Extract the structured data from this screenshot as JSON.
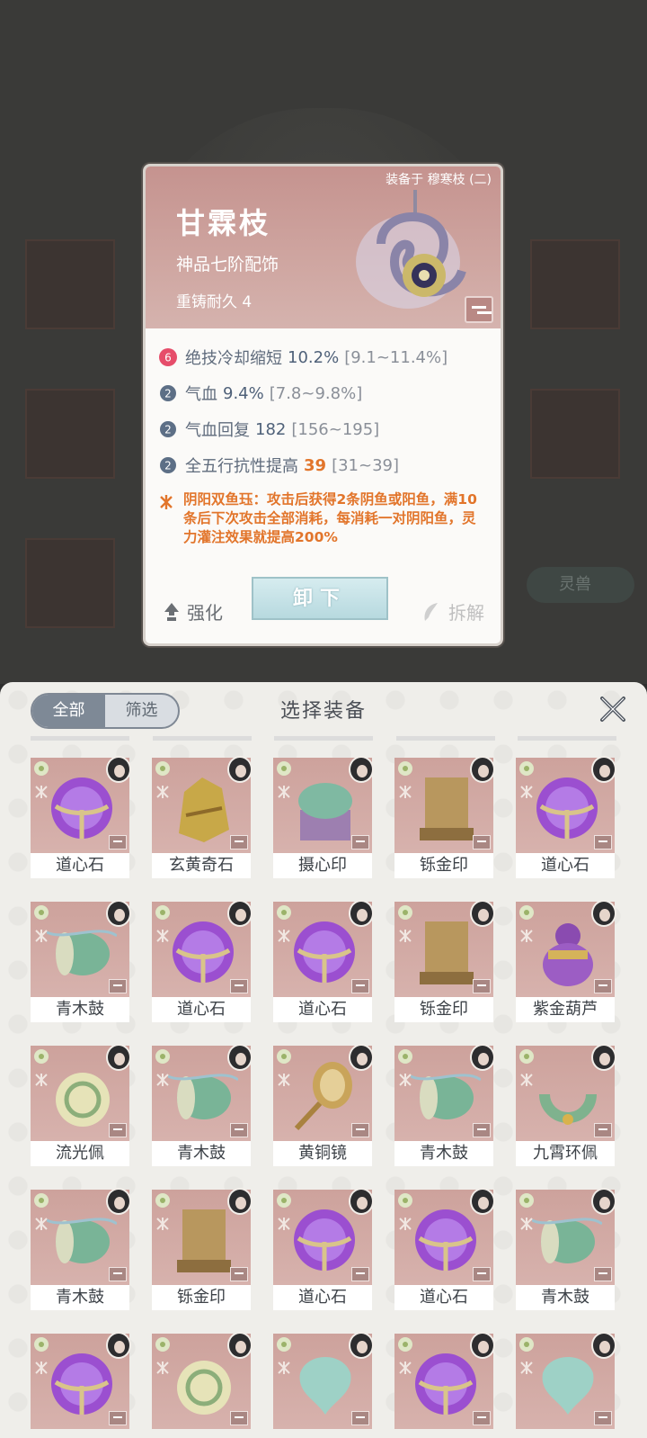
{
  "background": {
    "side_button": "灵兽"
  },
  "tooltip": {
    "equipped_on": "装备于 穆寒枝 (二)",
    "name": "甘霖枝",
    "grade": "神品七阶配饰",
    "durability": "重铸耐久 4",
    "stats": [
      {
        "icon": "rank-6-badge-icon",
        "label": "绝技冷却缩短",
        "value": "10.2%",
        "range": "[9.1~11.4%]",
        "highlight": false
      },
      {
        "icon": "blue-gem-icon",
        "label": "气血",
        "value": "9.4%",
        "range": "[7.8~9.8%]",
        "highlight": false
      },
      {
        "icon": "blue-gem-icon",
        "label": "气血回复",
        "value": "182",
        "range": "[156~195]",
        "highlight": false
      },
      {
        "icon": "blue-gem-icon",
        "label": "全五行抗性提高",
        "value": "39",
        "range": "[31~39]",
        "highlight": true
      }
    ],
    "special": "阴阳双鱼珏：攻击后获得2条阴鱼或阳鱼，满10条后下次攻击全部消耗，每消耗一对阴阳鱼，灵力灌注效果就提高200%",
    "actions": {
      "upgrade": "强化",
      "unequip": "卸下",
      "dismantle": "拆解"
    }
  },
  "sheet": {
    "filter_all": "全部",
    "filter_select": "筛选",
    "title": "选择装备",
    "items": [
      {
        "name": "道心石",
        "kind": "orb"
      },
      {
        "name": "玄黄奇石",
        "kind": "rock"
      },
      {
        "name": "摄心印",
        "kind": "seal-jade"
      },
      {
        "name": "铄金印",
        "kind": "seal"
      },
      {
        "name": "道心石",
        "kind": "orb"
      },
      {
        "name": "青木鼓",
        "kind": "drum"
      },
      {
        "name": "道心石",
        "kind": "orb"
      },
      {
        "name": "道心石",
        "kind": "orb"
      },
      {
        "name": "铄金印",
        "kind": "seal"
      },
      {
        "name": "紫金葫芦",
        "kind": "gourd"
      },
      {
        "name": "流光佩",
        "kind": "pendant"
      },
      {
        "name": "青木鼓",
        "kind": "drum"
      },
      {
        "name": "黄铜镜",
        "kind": "mirror"
      },
      {
        "name": "青木鼓",
        "kind": "drum"
      },
      {
        "name": "九霄环佩",
        "kind": "ring"
      },
      {
        "name": "青木鼓",
        "kind": "drum"
      },
      {
        "name": "铄金印",
        "kind": "seal"
      },
      {
        "name": "道心石",
        "kind": "orb"
      },
      {
        "name": "道心石",
        "kind": "orb"
      },
      {
        "name": "青木鼓",
        "kind": "drum"
      },
      {
        "name": "",
        "kind": "orb"
      },
      {
        "name": "",
        "kind": "pendant"
      },
      {
        "name": "",
        "kind": "jade"
      },
      {
        "name": "",
        "kind": "orb"
      },
      {
        "name": "",
        "kind": "jade"
      }
    ]
  },
  "colors": {
    "accent_orange": "#e2752b",
    "card_bg": "#cda29c",
    "stat_blue": "#4f6179"
  }
}
